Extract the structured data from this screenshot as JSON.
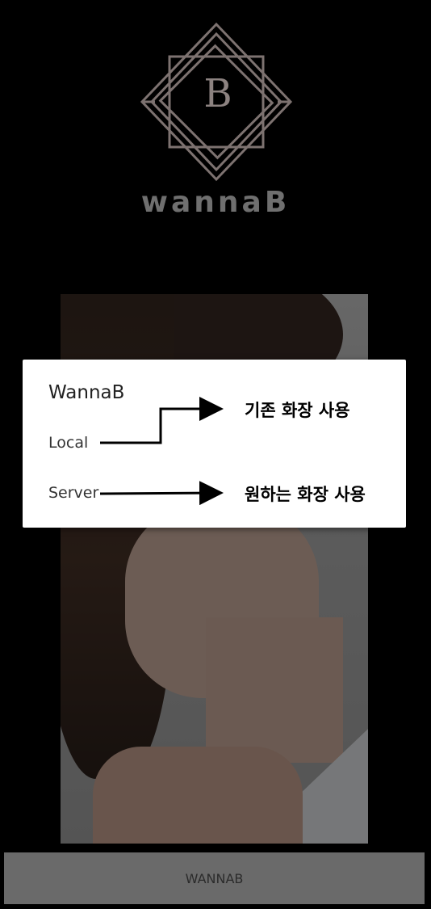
{
  "app": {
    "logo_letter": "B",
    "brand_name": "wannaB",
    "logo_color": "#8c8280"
  },
  "dialog": {
    "title": "WannaB",
    "options": [
      {
        "label": "Local"
      },
      {
        "label": "Server"
      }
    ]
  },
  "annotations": {
    "local_note": "기존 화장 사용",
    "server_note": "원하는 화장 사용"
  },
  "bottom_button": {
    "label": "WANNAB"
  },
  "icons": {
    "logo": "diamond-frame-logo-icon",
    "arrow": "arrow-right-icon"
  }
}
